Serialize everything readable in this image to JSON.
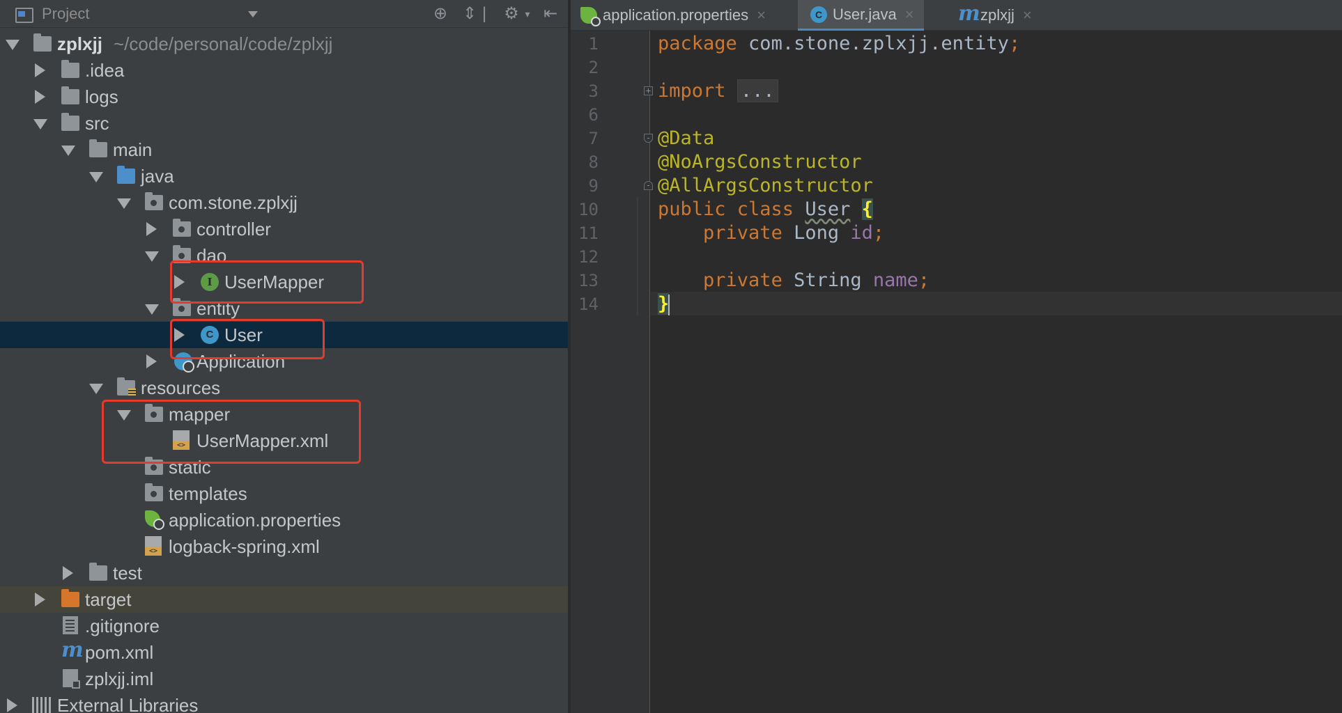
{
  "project_panel": {
    "title": "Project",
    "tools": [
      "locate-icon",
      "collapse-all-icon",
      "settings-icon",
      "hide-icon"
    ],
    "root": {
      "name": "zplxjj",
      "path": "~/code/personal/code/zplxjj"
    },
    "nodes": [
      {
        "label": ".idea"
      },
      {
        "label": "logs"
      },
      {
        "label": "src"
      },
      {
        "label": "main"
      },
      {
        "label": "java"
      },
      {
        "label": "com.stone.zplxjj"
      },
      {
        "label": "controller"
      },
      {
        "label": "dao"
      },
      {
        "label": "UserMapper",
        "icon_letter": "I"
      },
      {
        "label": "entity"
      },
      {
        "label": "User",
        "icon_letter": "C"
      },
      {
        "label": "Application"
      },
      {
        "label": "resources"
      },
      {
        "label": "mapper"
      },
      {
        "label": "UserMapper.xml"
      },
      {
        "label": "static"
      },
      {
        "label": "templates"
      },
      {
        "label": "application.properties"
      },
      {
        "label": "logback-spring.xml"
      },
      {
        "label": "test"
      },
      {
        "label": "target"
      },
      {
        "label": ".gitignore"
      },
      {
        "label": "pom.xml"
      },
      {
        "label": "zplxjj.iml"
      },
      {
        "label": "External Libraries"
      }
    ],
    "selected": "User",
    "highlight_color": "#e53b2c"
  },
  "editor": {
    "tabs": [
      {
        "label": "application.properties",
        "close": "×"
      },
      {
        "label": "User.java",
        "close": "×",
        "icon_letter": "C",
        "active": true
      },
      {
        "label": "zplxjj",
        "close": "×"
      }
    ],
    "line_numbers": [
      "1",
      "2",
      "3",
      "6",
      "7",
      "8",
      "9",
      "10",
      "11",
      "12",
      "13",
      "14"
    ],
    "code": {
      "l1_kw": "package",
      "l1_rest": " com.stone.zplxjj.entity",
      "l1_semi": ";",
      "l3_kw": "import",
      "l3_fold": "...",
      "l7": "@Data",
      "l8": "@NoArgsConstructor",
      "l9": "@AllArgsConstructor",
      "l10_kw": "public class",
      "l10_name": "User",
      "l10_brace": "{",
      "l11_kw": "private",
      "l11_type": " Long ",
      "l11_field": "id",
      "l11_semi": ";",
      "l13_kw": "private",
      "l13_type": " String ",
      "l13_field": "name",
      "l13_semi": ";",
      "l14_brace": "}"
    },
    "colors": {
      "keyword": "#cc7832",
      "annotation": "#bbb529",
      "field": "#9876aa",
      "text": "#a9b7c6"
    }
  }
}
